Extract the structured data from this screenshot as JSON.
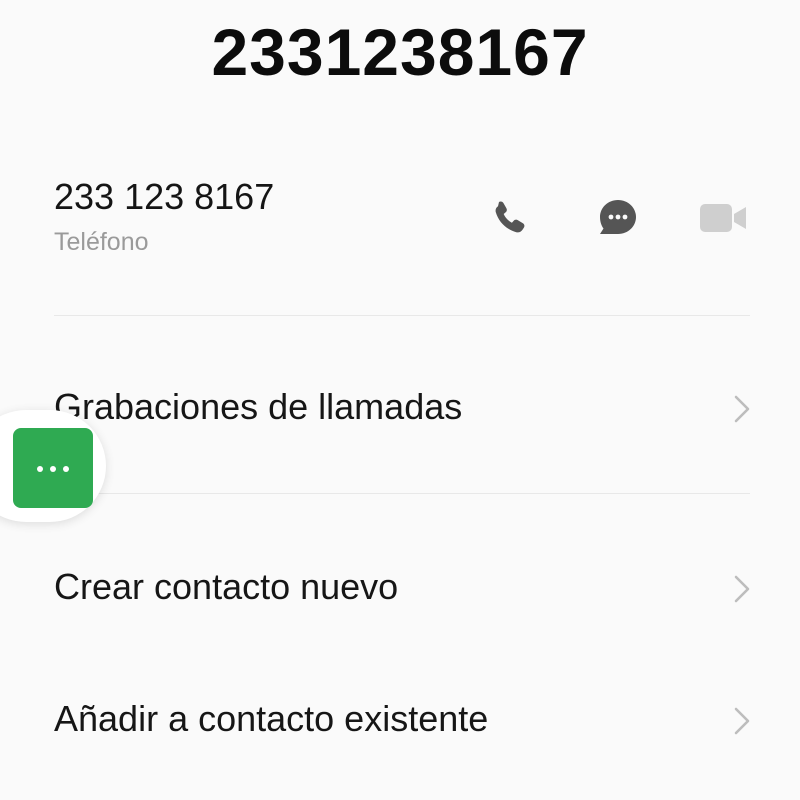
{
  "header": {
    "title": "2331238167"
  },
  "contact": {
    "number": "233 123 8167",
    "type": "Teléfono"
  },
  "actions": {
    "call_icon": "phone-icon",
    "message_icon": "message-bubble-icon",
    "video_icon": "video-camera-icon"
  },
  "menu": {
    "items": [
      {
        "label": "Grabaciones de llamadas"
      },
      {
        "label": "Crear contacto nuevo"
      },
      {
        "label": "Añadir a contacto existente"
      }
    ]
  },
  "floating": {
    "icon": "more-dots-icon",
    "color": "#2faa52"
  },
  "colors": {
    "icon_gray": "#555555",
    "icon_disabled": "#cfcfcf",
    "chevron": "#bdbdbd"
  }
}
